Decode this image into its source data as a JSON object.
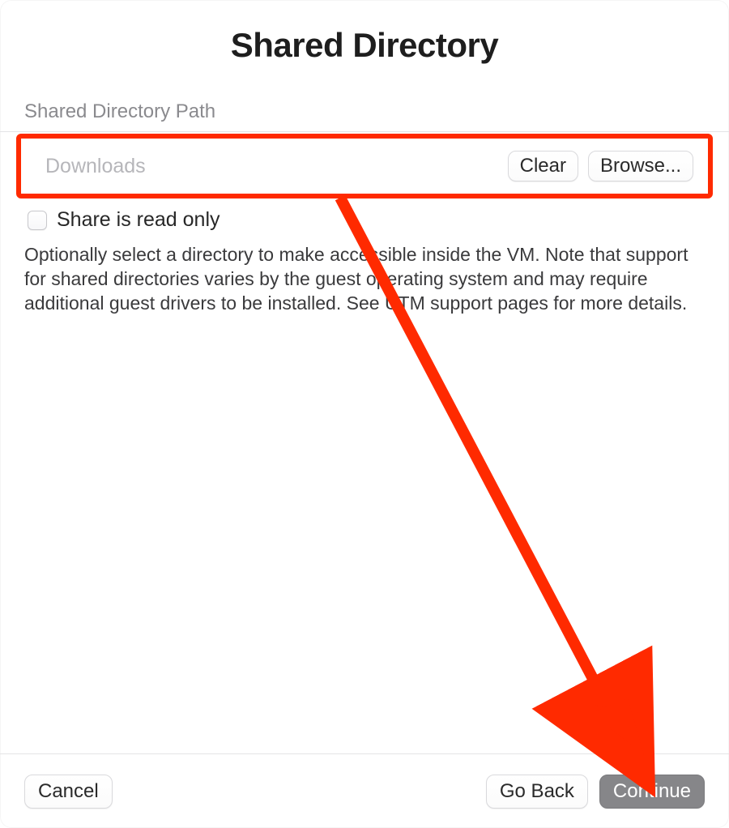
{
  "title": "Shared Directory",
  "section_label": "Shared Directory Path",
  "path_row": {
    "value": "Downloads",
    "clear_label": "Clear",
    "browse_label": "Browse..."
  },
  "readonly": {
    "label": "Share is read only",
    "checked": false
  },
  "help_text": "Optionally select a directory to make accessible inside the VM. Note that support for shared directories varies by the guest operating system and may require additional guest drivers to be installed. See UTM support pages for more details.",
  "footer": {
    "cancel_label": "Cancel",
    "go_back_label": "Go Back",
    "continue_label": "Continue"
  },
  "annotation": {
    "color": "#ff2a00"
  }
}
